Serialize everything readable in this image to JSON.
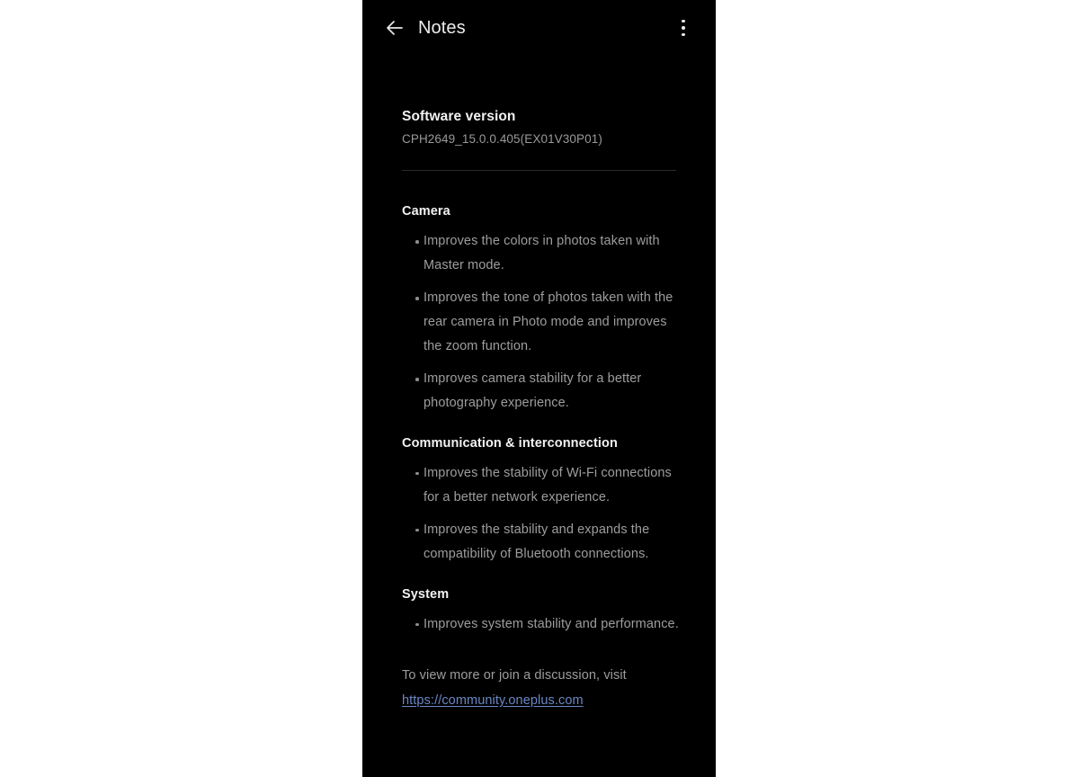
{
  "appbar": {
    "back_icon": "arrow-left-icon",
    "title": "Notes",
    "overflow_icon": "more-vertical-icon"
  },
  "software": {
    "label": "Software version",
    "value": "CPH2649_15.0.0.405(EX01V30P01)"
  },
  "sections": [
    {
      "title": "Camera",
      "items": [
        "Improves the colors in photos taken with Master mode.",
        "Improves the tone of photos taken with the rear camera in Photo mode and improves the zoom function.",
        "Improves camera stability for a better photography experience."
      ]
    },
    {
      "title": "Communication & interconnection",
      "items": [
        "Improves the stability of Wi-Fi connections for a better network experience.",
        "Improves the stability and expands the compatibility of Bluetooth connections."
      ]
    },
    {
      "title": "System",
      "items": [
        "Improves system stability and performance."
      ]
    }
  ],
  "footer": {
    "note": "To view more or join a discussion, visit",
    "link_text": "https://community.oneplus.com"
  },
  "colors": {
    "panel_background": "#000000",
    "page_background": "#ffffff",
    "heading_text": "#f2f2f2",
    "body_text": "#9d9d9d",
    "link": "#6b87c4",
    "divider": "#2a2a2a"
  }
}
